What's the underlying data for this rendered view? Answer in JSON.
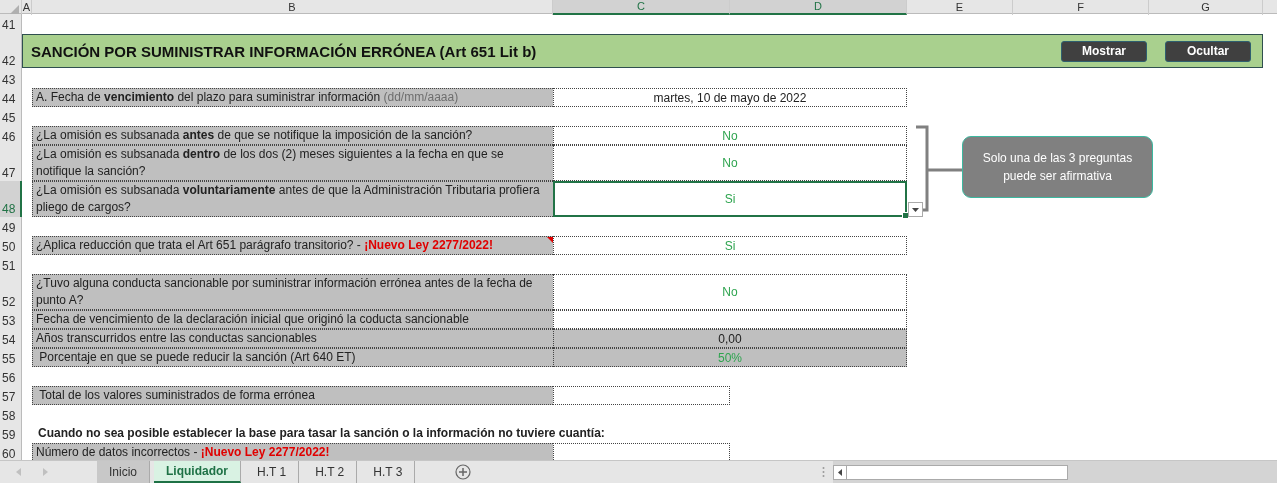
{
  "column_headers": [
    {
      "label": "A",
      "selected": false
    },
    {
      "label": "B",
      "selected": false
    },
    {
      "label": "C",
      "selected": true
    },
    {
      "label": "D",
      "selected": true
    },
    {
      "label": "E",
      "selected": false
    },
    {
      "label": "F",
      "selected": false
    },
    {
      "label": "G",
      "selected": false
    }
  ],
  "rows": [
    {
      "number": "41",
      "kind": "blank",
      "selected": false
    },
    {
      "number": "42",
      "kind": "title",
      "selected": false,
      "title": "SANCIÓN POR SUMINISTRAR INFORMACIÓN ERRÓNEA (Art 651 Lit b)",
      "buttons": [
        "Mostrar",
        "Ocultar"
      ]
    },
    {
      "number": "43",
      "kind": "blank",
      "selected": false
    },
    {
      "number": "44",
      "kind": "field",
      "selected": false,
      "label": "A. Fecha de **vencimiento** del plazo para suministrar información",
      "hint": "(dd/mm/aaaa)",
      "value": "martes, 10 de mayo de 2022",
      "highlighted": false,
      "shaded": false
    },
    {
      "number": "45",
      "kind": "blank",
      "selected": false
    },
    {
      "number": "46",
      "kind": "field",
      "selected": false,
      "label": "¿La omisión es subsanada **antes** de que se notifique la imposición de la sanción?",
      "value": "No",
      "highlighted": true,
      "shaded": false
    },
    {
      "number": "47",
      "kind": "field",
      "selected": false,
      "label": "¿La omisión es subsanada **dentro** de los dos (2) meses siguientes a la fecha en que se notifique la sanción?",
      "value": "No",
      "highlighted": true,
      "shaded": false
    },
    {
      "number": "48",
      "kind": "field",
      "selected": true,
      "label": "¿La omisión es subsanada **voluntariamente** antes de que la Administración Tributaria profiera pliego de cargos?",
      "value": "Si",
      "highlighted": true,
      "shaded": false
    },
    {
      "number": "49",
      "kind": "blank",
      "selected": false
    },
    {
      "number": "50",
      "kind": "field",
      "selected": false,
      "label": "¿Aplica reducción que trata el Art 651 parágrafo transitorio? - ",
      "note": "¡Nuevo Ley 2277/2022!",
      "has_comment": true,
      "value": "Si",
      "highlighted": true,
      "shaded": false
    },
    {
      "number": "51",
      "kind": "blank",
      "selected": false
    },
    {
      "number": "52",
      "kind": "field",
      "selected": false,
      "label": "¿Tuvo alguna conducta sancionable por suministrar información errónea antes de la fecha de punto A?",
      "value": "No",
      "highlighted": true,
      "shaded": false
    },
    {
      "number": "53",
      "kind": "field",
      "selected": false,
      "label": "Fecha de vencimiento de la declaración inicial que originó la coducta sancionable",
      "shaded": false
    },
    {
      "number": "54",
      "kind": "field",
      "selected": false,
      "label": "Años transcurridos entre las conductas sancionables",
      "value": "0,00",
      "highlighted": false,
      "shaded": true
    },
    {
      "number": "55",
      "kind": "field",
      "selected": false,
      "label": " Porcentaje en que se puede reducir la sanción (Art 640 ET)",
      "value": "50%",
      "highlighted": true,
      "shaded": true
    },
    {
      "number": "56",
      "kind": "blank",
      "selected": false
    },
    {
      "number": "57",
      "kind": "total",
      "selected": false,
      "label": " Total de los valores suministrados de forma errónea"
    },
    {
      "number": "58",
      "kind": "blank",
      "selected": false
    },
    {
      "number": "59",
      "kind": "note",
      "selected": false,
      "text": "Cuando no sea posible establecer la base para tasar la sanción o la información no tuviere cuantía:"
    },
    {
      "number": "60",
      "kind": "total",
      "selected": false,
      "label": "Número de datos incorrectos - ",
      "note": "¡Nuevo Ley 2277/2022!"
    }
  ],
  "callout": {
    "text": "Solo una de las 3 preguntas puede ser afirmativa"
  },
  "sheet_tabs": [
    {
      "label": "Inicio",
      "selected": false,
      "color": "#c8c8c8"
    },
    {
      "label": "Liquidador",
      "selected": true,
      "color": "#d9f2e3"
    },
    {
      "label": "H.T 1",
      "selected": false
    },
    {
      "label": "H.T 2",
      "selected": false
    },
    {
      "label": "H.T 3",
      "selected": false
    }
  ]
}
